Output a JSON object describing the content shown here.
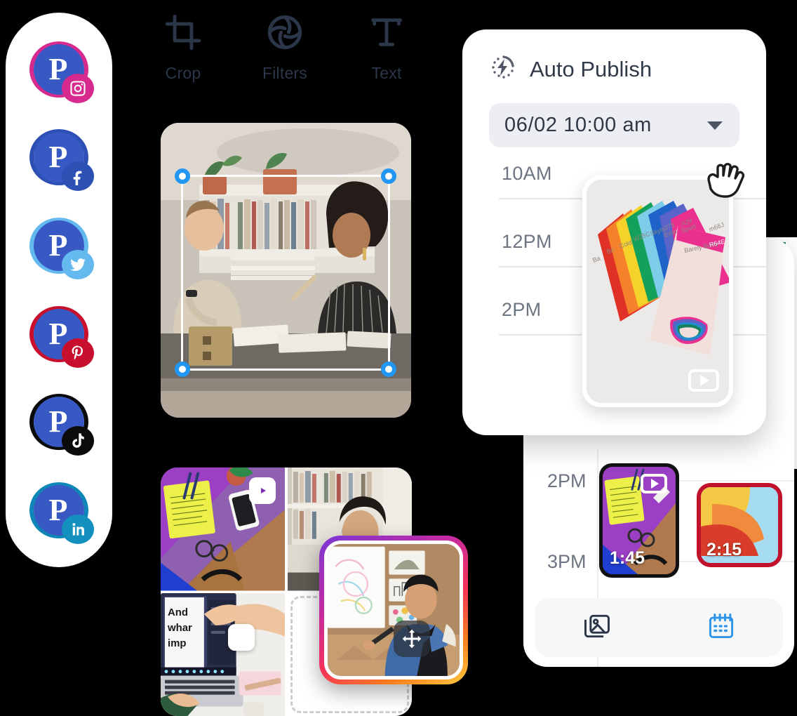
{
  "social_rail": {
    "items": [
      {
        "network": "instagram",
        "label": "Instagram",
        "avatar_letter": "P",
        "ring_color": "#d62a8e",
        "badge_color": "#d62a8e"
      },
      {
        "network": "facebook",
        "label": "Facebook",
        "avatar_letter": "P",
        "ring_color": "#2d50b5",
        "badge_color": "#2d50b5"
      },
      {
        "network": "twitter",
        "label": "Twitter",
        "avatar_letter": "P",
        "ring_color": "#64b9ef",
        "badge_color": "#64b9ef"
      },
      {
        "network": "pinterest",
        "label": "Pinterest",
        "avatar_letter": "P",
        "ring_color": "#c8102e",
        "badge_color": "#c8102e"
      },
      {
        "network": "tiktok",
        "label": "TikTok",
        "avatar_letter": "P",
        "ring_color": "#0b0b0b",
        "badge_color": "#0b0b0b"
      },
      {
        "network": "linkedin",
        "label": "LinkedIn",
        "avatar_letter": "P",
        "ring_color": "#0e86b8",
        "badge_color": "#1490be"
      }
    ]
  },
  "editor": {
    "toolbar": [
      {
        "icon": "crop-icon",
        "label": "Crop"
      },
      {
        "icon": "filters-icon",
        "label": "Filters"
      },
      {
        "icon": "text-icon",
        "label": "Text"
      }
    ],
    "crop_selection": {
      "handles": 4,
      "handle_color": "#2196f3",
      "frame_color": "#ffffff"
    },
    "grid": {
      "cells": [
        {
          "name": "desk-flatlay",
          "badge": "reels-icon"
        },
        {
          "name": "woman-at-bookshelf",
          "badge": ""
        },
        {
          "name": "laptop-editing",
          "badge": "square-badge"
        },
        {
          "name": "empty-drop-slot",
          "badge": ""
        }
      ]
    },
    "floating_card": {
      "name": "artist-presenting",
      "border": "instagram-gradient",
      "handle": "move-icon"
    }
  },
  "auto_publish": {
    "icon": "auto-publish-icon",
    "title": "Auto Publish",
    "datetime_value": "06/02  10:00 am",
    "caret": "chevron-down-icon",
    "timeline": [
      {
        "label": "10AM"
      },
      {
        "label": "12PM"
      },
      {
        "label": "2PM"
      }
    ],
    "dragged_media": {
      "name": "paint-swatches",
      "badge": "play-icon"
    },
    "cursor": "grab-hand-icon"
  },
  "calendar_panel": {
    "timeline": [
      {
        "label": "2PM"
      },
      {
        "label": "3PM"
      }
    ],
    "events": [
      {
        "name": "desk-flatlay-video",
        "duration": "1:45",
        "badge": "play-icon",
        "accent": "#111111"
      },
      {
        "name": "paper-fold-image",
        "duration": "2:15",
        "badge": "",
        "accent": "#c0122b"
      }
    ],
    "bottom_bar": [
      {
        "icon": "media-library-icon",
        "active": false,
        "color": "#2b3648"
      },
      {
        "icon": "calendar-icon",
        "active": true,
        "color": "#2f93e8"
      }
    ]
  },
  "theme": {
    "accent_blue": "#2196f3",
    "panel_bg": "#ffffff",
    "field_bg": "#eceef3",
    "text_dark": "#2b3648",
    "text_muted": "#6d7482",
    "line": "#e3e7ee",
    "avatar_blue": "#3859c4"
  }
}
